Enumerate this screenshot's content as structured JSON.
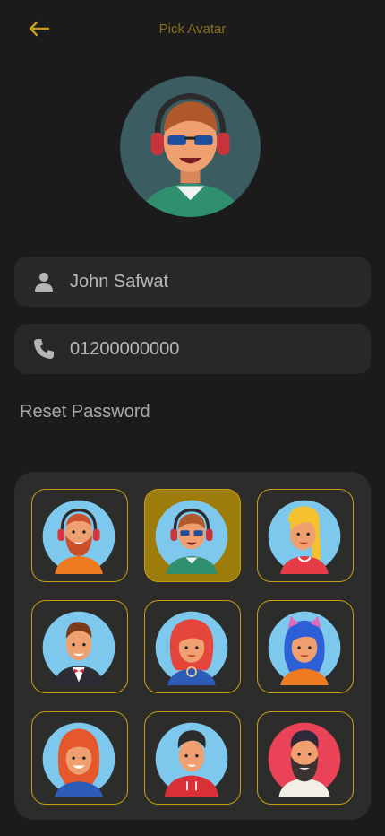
{
  "header": {
    "title": "Pick Avatar",
    "back_icon": "arrow-left-icon"
  },
  "accent_color": "#c89d17",
  "selected_color": "#9c7d0c",
  "form": {
    "name_value": "John Safwat",
    "phone_value": "01200000000",
    "name_icon": "person-icon",
    "phone_icon": "phone-icon"
  },
  "reset_password_label": "Reset Password",
  "avatar_grid": {
    "selected_index": 1,
    "avatars": [
      "bearded-man-headphones",
      "man-sunglasses-headphones",
      "blonde-woman",
      "man-tuxedo-bowtie",
      "red-haired-woman",
      "blue-haired-girl-cat-ears",
      "ginger-woman",
      "man-red-hoodie",
      "bearded-man"
    ]
  }
}
